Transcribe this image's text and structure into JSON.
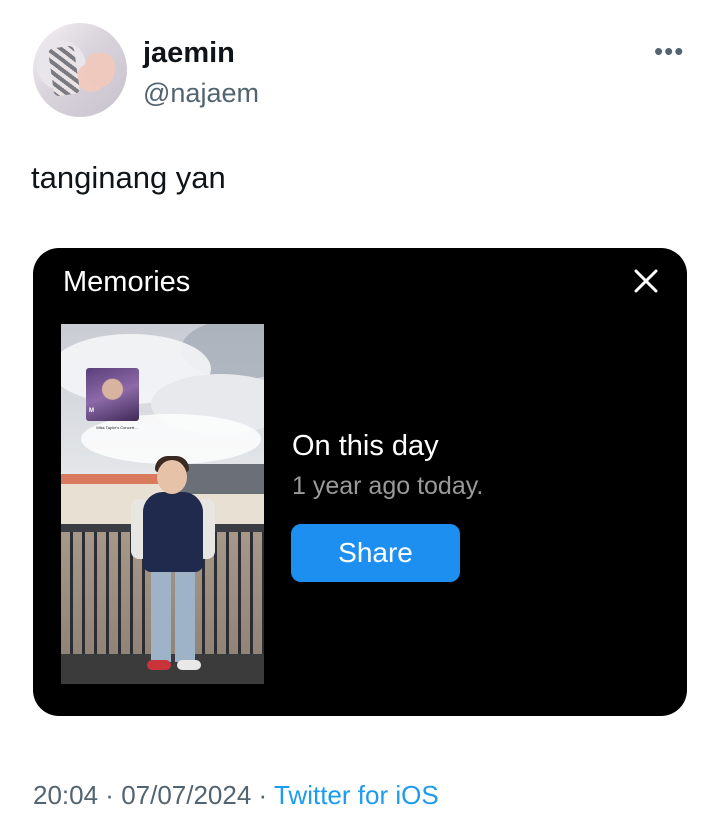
{
  "author": {
    "display_name": "jaemin",
    "handle": "@najaem"
  },
  "more_icon": "ellipsis-icon",
  "tweet": {
    "text": "tanginang yan"
  },
  "memories_card": {
    "title": "Memories",
    "close_icon": "close-icon",
    "album_art": {
      "logo": "M",
      "caption": "Miss Taylor's Concert..."
    },
    "heading": "On this day",
    "subheading": "1 year ago today.",
    "share_label": "Share",
    "accent_color": "#1d8ff0"
  },
  "footer": {
    "time": "20:04",
    "sep1": " · ",
    "date": "07/07/2024",
    "sep2": " · ",
    "source": "Twitter for iOS",
    "source_color": "#1d9bf0"
  }
}
